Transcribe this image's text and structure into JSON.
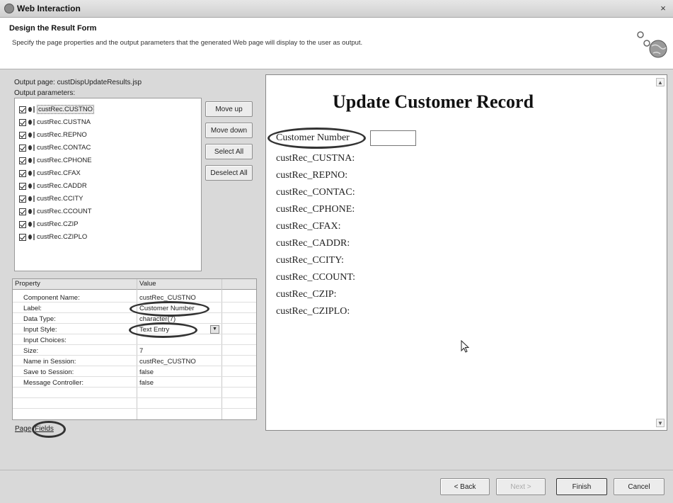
{
  "window": {
    "title": "Web Interaction",
    "close_glyph": "×"
  },
  "header": {
    "title": "Design the Result Form",
    "description": "Specify the page properties and the output parameters that the generated Web page will display to the user as output."
  },
  "left": {
    "output_page": "Output page: custDispUpdateResults.jsp",
    "output_params_label": "Output parameters:",
    "params": [
      "custRec.CUSTNO",
      "custRec.CUSTNA",
      "custRec.REPNO",
      "custRec.CONTAC",
      "custRec.CPHONE",
      "custRec.CFAX",
      "custRec.CADDR",
      "custRec.CCITY",
      "custRec.CCOUNT",
      "custRec.CZIP",
      "custRec.CZIPLO"
    ],
    "buttons": {
      "move_up": "Move up",
      "move_down": "Move down",
      "select_all": "Select All",
      "deselect_all": "Deselect All"
    }
  },
  "properties": {
    "header_property": "Property",
    "header_value": "Value",
    "rows": [
      {
        "name": "Component Name:",
        "value": "custRec_CUSTNO"
      },
      {
        "name": "Label:",
        "value": "Customer Number"
      },
      {
        "name": "Data Type:",
        "value": "character(7)"
      },
      {
        "name": "Input Style:",
        "value": "Text Entry"
      },
      {
        "name": "Input Choices:",
        "value": ""
      },
      {
        "name": "Size:",
        "value": "7"
      },
      {
        "name": "Name in Session:",
        "value": "custRec_CUSTNO"
      },
      {
        "name": "Save to Session:",
        "value": "false"
      },
      {
        "name": "Message Controller:",
        "value": "false"
      }
    ],
    "dropdown_glyph": "▼"
  },
  "tabs": {
    "page": "Page",
    "fields": "Fields"
  },
  "preview": {
    "title": "Update Customer Record",
    "first_label": "Customer Number",
    "fields": [
      "custRec_CUSTNA:",
      "custRec_REPNO:",
      "custRec_CONTAC:",
      "custRec_CPHONE:",
      "custRec_CFAX:",
      "custRec_CADDR:",
      "custRec_CCITY:",
      "custRec_CCOUNT:",
      "custRec_CZIP:",
      "custRec_CZIPLO:"
    ],
    "scroll_up": "▲",
    "scroll_down": "▼"
  },
  "footer": {
    "back": "< Back",
    "next": "Next >",
    "finish": "Finish",
    "cancel": "Cancel"
  }
}
